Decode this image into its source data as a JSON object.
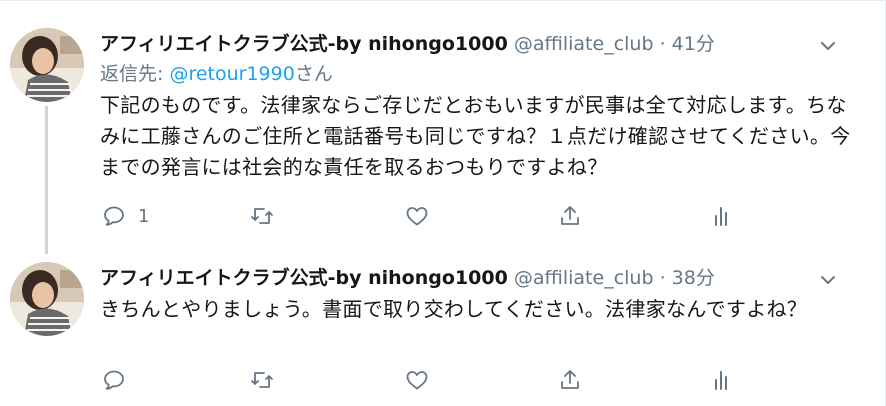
{
  "tweets": [
    {
      "display_name": "アフィリエイトクラブ公式-by nihongo1000",
      "handle": "@affiliate_club",
      "separator": "·",
      "time": "41分",
      "reply_prefix": "返信先: ",
      "reply_mention": "@retour1990",
      "reply_suffix": "さん",
      "text": "下記のものです。法律家ならご存じだとおもいますが民事は全て対応します。ちなみに工藤さんのご住所と電話番号も同じですね？１点だけ確認させてください。今までの発言には社会的な責任を取るおつもりですよね？",
      "reply_count": "1"
    },
    {
      "display_name": "アフィリエイトクラブ公式-by nihongo1000",
      "handle": "@affiliate_club",
      "separator": "·",
      "time": "38分",
      "text": "きちんとやりましょう。書面で取り交わしてください。法律家なんですよね？",
      "reply_count": ""
    }
  ],
  "icons": [
    "chevron-down-icon",
    "reply-icon",
    "retweet-icon",
    "like-icon",
    "share-icon",
    "analytics-icon"
  ],
  "colors": {
    "link": "#1da1f2",
    "muted": "#657786",
    "text": "#14171a",
    "thread_line": "#ccd6dd"
  }
}
